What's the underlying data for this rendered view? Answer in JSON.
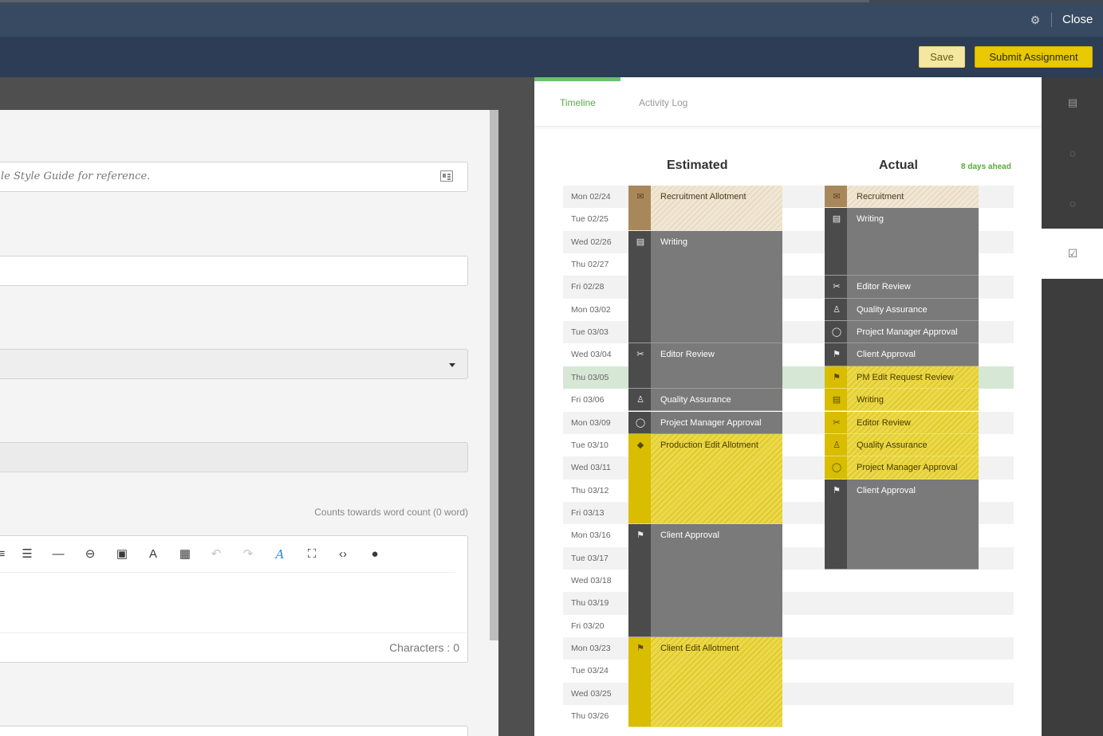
{
  "header": {
    "close_label": "Close",
    "settings_icon": "gear-icon"
  },
  "actions": {
    "save_label": "Save",
    "submit_label": "Submit Assignment"
  },
  "form": {
    "style_guide_placeholder": "le Style Guide for reference.",
    "word_count_note": "Counts towards word count (0 word)",
    "characters_label": "Characters : 0"
  },
  "tabs": {
    "timeline": "Timeline",
    "activity_log": "Activity Log"
  },
  "timeline": {
    "estimated_heading": "Estimated",
    "actual_heading": "Actual",
    "ahead_label": "8 days ahead",
    "current_row": 8,
    "dates": [
      "Mon 02/24",
      "Tue 02/25",
      "Wed 02/26",
      "Thu 02/27",
      "Fri 02/28",
      "Mon 03/02",
      "Tue 03/03",
      "Wed 03/04",
      "Thu 03/05",
      "Fri 03/06",
      "Mon 03/09",
      "Tue 03/10",
      "Wed 03/11",
      "Thu 03/12",
      "Fri 03/13",
      "Mon 03/16",
      "Tue 03/17",
      "Wed 03/18",
      "Thu 03/19",
      "Fri 03/20",
      "Mon 03/23",
      "Tue 03/24",
      "Wed 03/25",
      "Thu 03/26"
    ],
    "estimated": [
      {
        "label": "Recruitment Allotment",
        "start": 0,
        "span": 2,
        "style": "tan",
        "icon": "envelope-icon"
      },
      {
        "label": "Writing",
        "start": 2,
        "span": 5,
        "style": "gry",
        "icon": "newspaper-icon"
      },
      {
        "label": "Editor Review",
        "start": 7,
        "span": 2,
        "style": "gry",
        "icon": "scissors-icon"
      },
      {
        "label": "Quality Assurance",
        "start": 9,
        "span": 1,
        "style": "gry",
        "icon": "thumbs-up-icon"
      },
      {
        "label": "Project Manager Approval",
        "start": 10,
        "span": 1,
        "style": "gry",
        "icon": "speech-bubble-icon"
      },
      {
        "label": "Production Edit Allotment",
        "start": 11,
        "span": 4,
        "style": "yel",
        "icon": "eraser-icon"
      },
      {
        "label": "Client Approval",
        "start": 15,
        "span": 5,
        "style": "gry",
        "icon": "checkered-flag-icon"
      },
      {
        "label": "Client Edit Allotment",
        "start": 20,
        "span": 4,
        "style": "yel",
        "icon": "flag-icon"
      }
    ],
    "actual": [
      {
        "label": "Recruitment",
        "start": 0,
        "span": 1,
        "style": "tan",
        "icon": "envelope-icon"
      },
      {
        "label": "Writing",
        "start": 1,
        "span": 3,
        "style": "gry",
        "icon": "newspaper-icon"
      },
      {
        "label": "Editor Review",
        "start": 4,
        "span": 1,
        "style": "gry",
        "icon": "scissors-icon"
      },
      {
        "label": "Quality Assurance",
        "start": 5,
        "span": 1,
        "style": "gry",
        "icon": "thumbs-up-icon"
      },
      {
        "label": "Project Manager Approval",
        "start": 6,
        "span": 1,
        "style": "gry",
        "icon": "speech-bubble-icon"
      },
      {
        "label": "Client Approval",
        "start": 7,
        "span": 1,
        "style": "gry",
        "icon": "checkered-flag-icon"
      },
      {
        "label": "PM Edit Request Review",
        "start": 8,
        "span": 1,
        "style": "yel",
        "icon": "flag-icon"
      },
      {
        "label": "Writing",
        "start": 9,
        "span": 1,
        "style": "yel",
        "icon": "newspaper-icon"
      },
      {
        "label": "Editor Review",
        "start": 10,
        "span": 1,
        "style": "yel",
        "icon": "scissors-icon"
      },
      {
        "label": "Quality Assurance",
        "start": 11,
        "span": 1,
        "style": "yel",
        "icon": "thumbs-up-icon"
      },
      {
        "label": "Project Manager Approval",
        "start": 12,
        "span": 1,
        "style": "yel",
        "icon": "speech-bubble-icon"
      },
      {
        "label": "Client Approval",
        "start": 13,
        "span": 4,
        "style": "gry",
        "icon": "checkered-flag-icon"
      }
    ]
  },
  "rail": {
    "items": [
      "document-icon",
      "comment-icon",
      "chat-icon",
      "checklist-icon"
    ],
    "active_index": 3
  },
  "colors": {
    "accent_green": "#6cc070",
    "submit_yellow": "#e8c800",
    "save_yellow": "#f4e7a0",
    "header_blue": "#384a61"
  }
}
